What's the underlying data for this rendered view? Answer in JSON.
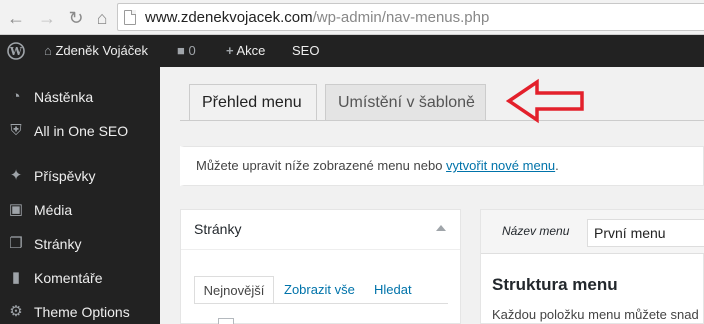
{
  "browser": {
    "url_domain": "www.zdenekvojacek.com",
    "url_path": "/wp-admin/nav-menus.php"
  },
  "adminbar": {
    "site_name": "Zdeněk Vojáček",
    "comments_count": "0",
    "new_label": "Akce",
    "seo_label": "SEO"
  },
  "sidebar": {
    "items": [
      {
        "label": "Nástěnka",
        "icon": "dashboard-icon"
      },
      {
        "label": "All in One SEO",
        "icon": "shield-icon"
      },
      {
        "label": "Příspěvky",
        "icon": "pin-icon"
      },
      {
        "label": "Média",
        "icon": "media-icon"
      },
      {
        "label": "Stránky",
        "icon": "pages-icon"
      },
      {
        "label": "Komentáře",
        "icon": "comment-icon"
      },
      {
        "label": "Theme Options",
        "icon": "gear-icon"
      }
    ]
  },
  "tabs": {
    "active": "Přehled menu",
    "inactive": "Umístění v šabloně"
  },
  "notice": {
    "text": "Můžete upravit níže zobrazené menu nebo ",
    "link": "vytvořit nové menu",
    "end": "."
  },
  "pages_panel": {
    "title": "Stránky",
    "tabs": [
      "Nejnovější",
      "Zobrazit vše",
      "Hledat"
    ]
  },
  "menu_panel": {
    "name_label": "Název menu",
    "name_value": "První menu",
    "structure_title": "Struktura menu",
    "structure_text": "Každou položku menu můžete snad"
  },
  "colors": {
    "accent": "#0073aa",
    "annotation_arrow": "#e3202b",
    "admin_dark": "#222222"
  }
}
